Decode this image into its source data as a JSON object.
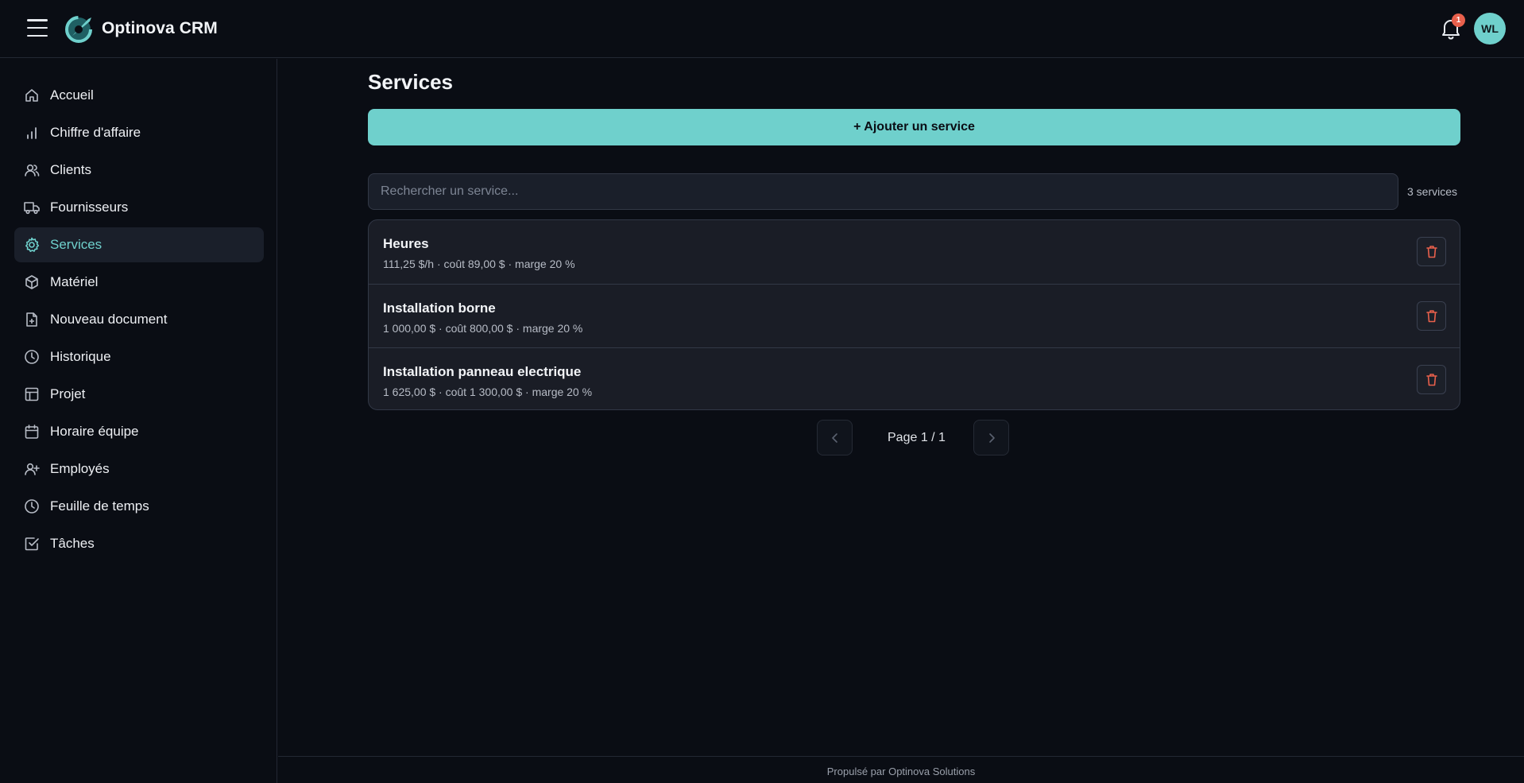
{
  "app": {
    "title": "Optinova CRM"
  },
  "header": {
    "notification_count": "1",
    "avatar_initials": "WL"
  },
  "sidebar": {
    "items": [
      {
        "label": "Accueil",
        "icon": "home-icon"
      },
      {
        "label": "Chiffre d'affaire",
        "icon": "bar-chart-icon"
      },
      {
        "label": "Clients",
        "icon": "users-icon"
      },
      {
        "label": "Fournisseurs",
        "icon": "truck-icon"
      },
      {
        "label": "Services",
        "icon": "gear-icon",
        "active": true
      },
      {
        "label": "Matériel",
        "icon": "box-icon"
      },
      {
        "label": "Nouveau document",
        "icon": "file-plus-icon"
      },
      {
        "label": "Historique",
        "icon": "clock-icon"
      },
      {
        "label": "Projet",
        "icon": "layout-icon"
      },
      {
        "label": "Horaire équipe",
        "icon": "calendar-icon"
      },
      {
        "label": "Employés",
        "icon": "user-plus-icon"
      },
      {
        "label": "Feuille de temps",
        "icon": "clock-icon"
      },
      {
        "label": "Tâches",
        "icon": "check-square-icon"
      }
    ]
  },
  "main": {
    "title": "Services",
    "add_button": "+ Ajouter un service",
    "search": {
      "placeholder": "Rechercher un service...",
      "value": ""
    },
    "count": "3 services",
    "services": [
      {
        "name": "Heures",
        "details": "111,25 $/h · coût 89,00 $ · marge 20 %"
      },
      {
        "name": "Installation borne",
        "details": "1 000,00 $ · coût 800,00 $ · marge 20 %"
      },
      {
        "name": "Installation panneau electrique",
        "details": "1 625,00 $ · coût 1 300,00 $ · marge 20 %"
      }
    ],
    "pagination": {
      "text": "Page 1 / 1"
    }
  },
  "footer": {
    "text": "Propulsé par Optinova Solutions"
  },
  "colors": {
    "accent": "#6fd0cc",
    "danger": "#e8604c",
    "background": "#0a0d14"
  }
}
